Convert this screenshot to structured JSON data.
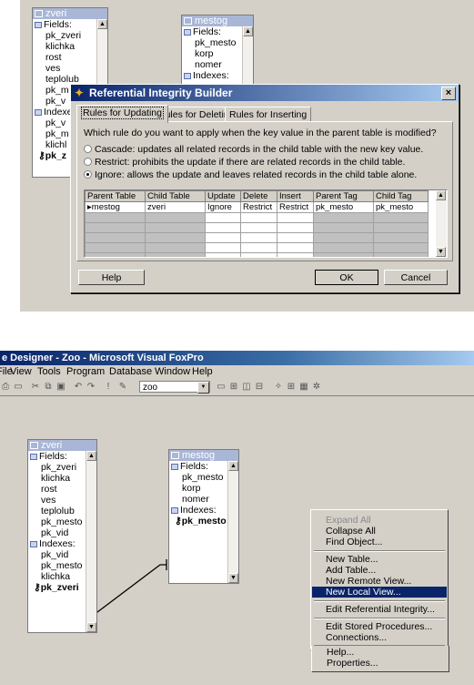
{
  "colors": {
    "panel": "#d4d0c8",
    "title_active": "#0a246a",
    "table_header": "#a9b6d6",
    "selection": "#0a246a"
  },
  "top": {
    "zveri": {
      "title": "zveri",
      "fields_label": "Fields:",
      "fields": [
        "pk_zveri",
        "klichka",
        "rost",
        "ves",
        "teplolub",
        "pk_m",
        "pk_v"
      ],
      "indexes_label": "Indexes:",
      "indexes": [
        "pk_v",
        "pk_m",
        "klichl"
      ],
      "primary_key": "pk_z"
    },
    "mestog": {
      "title": "mestog",
      "fields_label": "Fields:",
      "fields": [
        "pk_mesto",
        "korp",
        "nomer"
      ],
      "indexes_label": "Indexes:"
    },
    "dialog": {
      "title": "Referential Integrity Builder",
      "close_label": "×",
      "icon": "wizard-icon",
      "tabs": [
        "Rules for Updating",
        "Rules for Deleting",
        "Rules for Inserting"
      ],
      "question": "Which rule do you want to apply when the key value in the parent table is modified?",
      "options": [
        {
          "label": "Cascade: updates all related records in the child table with the new key value.",
          "selected": false
        },
        {
          "label": "Restrict: prohibits the update if there are related records in the child table.",
          "selected": false
        },
        {
          "label": "Ignore: allows the update and leaves related records in the child table alone.",
          "selected": true
        }
      ],
      "columns": [
        "Parent Table",
        "Child Table",
        "Update",
        "Delete",
        "Insert",
        "Parent Tag",
        "Child Tag"
      ],
      "rows": [
        [
          "mestog",
          "zveri",
          "Ignore",
          "Restrict",
          "Restrict",
          "pk_mesto",
          "pk_mesto"
        ]
      ],
      "help_label": "Help",
      "ok_label": "OK",
      "cancel_label": "Cancel"
    }
  },
  "bottom": {
    "window_title": "e Designer - Zoo - Microsoft Visual FoxPro",
    "menu": [
      "File",
      "View",
      "Tools",
      "Program",
      "Database",
      "Window",
      "Help"
    ],
    "database_combo": "zoo",
    "zveri": {
      "title": "zveri",
      "fields_label": "Fields:",
      "fields": [
        "pk_zveri",
        "klichka",
        "rost",
        "ves",
        "teplolub",
        "pk_mesto",
        "pk_vid"
      ],
      "indexes_label": "Indexes:",
      "indexes": [
        "pk_vid",
        "pk_mesto",
        "klichka"
      ],
      "primary_key": "pk_zveri"
    },
    "mestog": {
      "title": "mestog",
      "fields_label": "Fields:",
      "fields": [
        "pk_mesto",
        "korp",
        "nomer"
      ],
      "indexes_label": "Indexes:",
      "primary_key": "pk_mesto"
    },
    "context_menu": [
      {
        "label": "Expand All",
        "disabled": true
      },
      {
        "label": "Collapse All"
      },
      {
        "label": "Find Object..."
      },
      {
        "label": "New Table..."
      },
      {
        "label": "Add Table..."
      },
      {
        "label": "New Remote View..."
      },
      {
        "label": "New Local View...",
        "highlighted": true
      },
      {
        "label": "Edit Referential Integrity..."
      },
      {
        "label": "Edit Stored Procedures..."
      },
      {
        "label": "Connections..."
      },
      {
        "label": "Help..."
      },
      {
        "label": "Properties..."
      }
    ]
  }
}
